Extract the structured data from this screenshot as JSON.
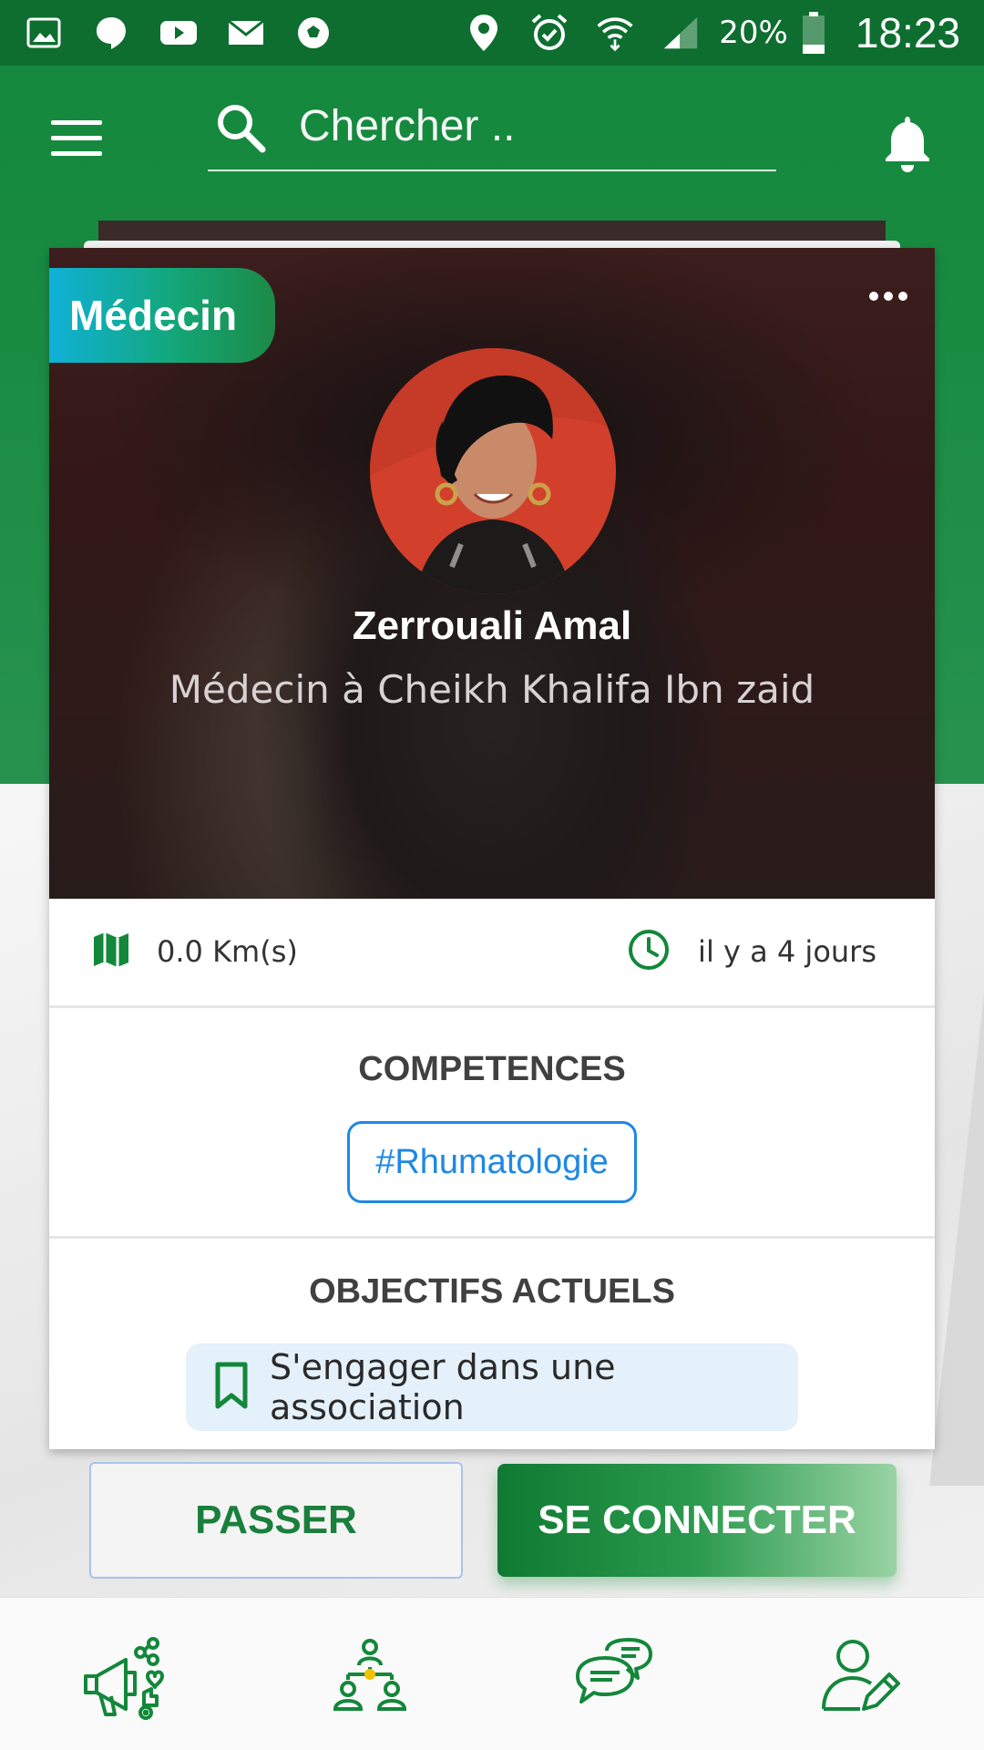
{
  "status_bar": {
    "battery_pct": "20%",
    "time": "18:23"
  },
  "toolbar": {
    "search_placeholder": "Chercher .."
  },
  "card": {
    "role_badge": "Médecin",
    "name": "Zerrouali Amal",
    "title": "Médecin à Cheikh Khalifa Ibn zaid",
    "distance": "0.0 Km(s)",
    "time_ago": "il y a  4 jours",
    "competences_title": "COMPETENCES",
    "skills": [
      "#Rhumatologie"
    ],
    "objectives_title": "OBJECTIFS ACTUELS",
    "goals": [
      "S'engager dans une association"
    ]
  },
  "actions": {
    "skip_label": "PASSER",
    "connect_label": "SE CONNECTER"
  },
  "bottom_nav": {
    "items": [
      "promote-icon",
      "network-icon",
      "chat-icon",
      "edit-profile-icon"
    ]
  },
  "colors": {
    "primary_green": "#12873a",
    "accent_blue": "#1e88e5"
  }
}
